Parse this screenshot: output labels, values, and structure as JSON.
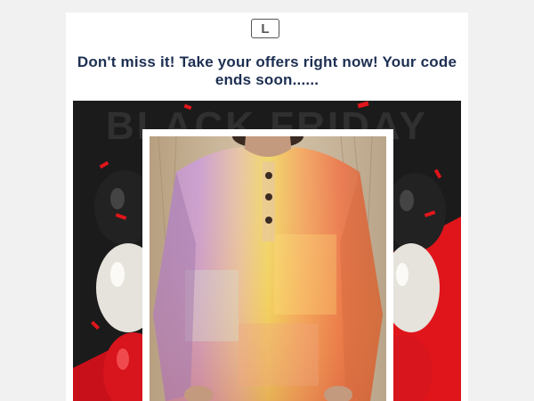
{
  "brand": {
    "logo_letter": "L"
  },
  "headline": "Don't miss it! Take your offers right now! Your code ends soon......",
  "banner": {
    "background_text": "BLACK FRIDAY",
    "colors": {
      "dark": "#1b1b1b",
      "red": "#e0151b",
      "balloon_white": "#e6e3dc"
    }
  },
  "product": {
    "image": "sweater-photo"
  }
}
